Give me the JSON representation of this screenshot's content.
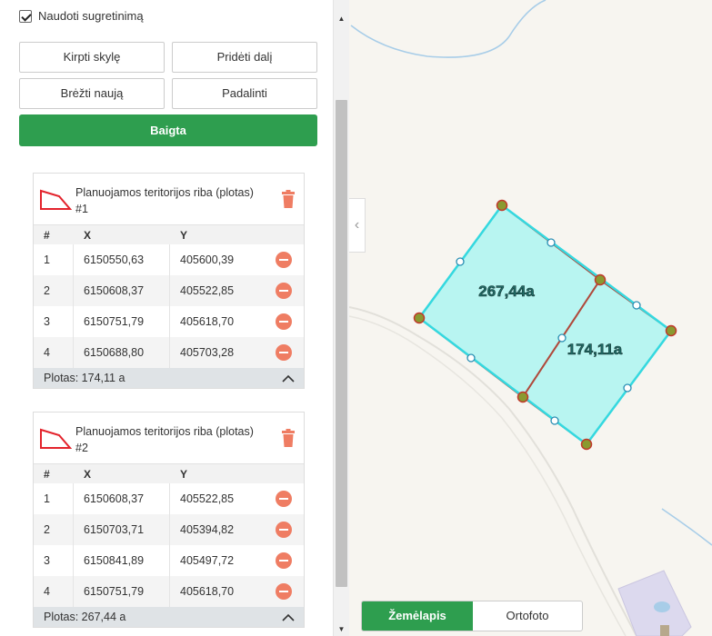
{
  "panel": {
    "checkbox_label": "Naudoti sugretinimą",
    "buttons": {
      "cut_hole": "Kirpti skylę",
      "add_part": "Pridėti dalį",
      "draw_new": "Brėžti naują",
      "split": "Padalinti",
      "done": "Baigta"
    },
    "table_headers": {
      "num": "#",
      "x": "X",
      "y": "Y"
    },
    "cards": [
      {
        "title": "Planuojamos teritorijos riba (plotas) #1",
        "rows": [
          {
            "n": "1",
            "x": "6150550,63",
            "y": "405600,39"
          },
          {
            "n": "2",
            "x": "6150608,37",
            "y": "405522,85"
          },
          {
            "n": "3",
            "x": "6150751,79",
            "y": "405618,70"
          },
          {
            "n": "4",
            "x": "6150688,80",
            "y": "405703,28"
          }
        ],
        "footer": "Plotas: 174,11 a"
      },
      {
        "title": "Planuojamos teritorijos riba (plotas) #2",
        "rows": [
          {
            "n": "1",
            "x": "6150608,37",
            "y": "405522,85"
          },
          {
            "n": "2",
            "x": "6150703,71",
            "y": "405394,82"
          },
          {
            "n": "3",
            "x": "6150841,89",
            "y": "405497,72"
          },
          {
            "n": "4",
            "x": "6150751,79",
            "y": "405618,70"
          }
        ],
        "footer": "Plotas: 267,44 a"
      }
    ]
  },
  "map": {
    "labels": {
      "parcel_a": "267,44a",
      "parcel_b": "174,11a"
    },
    "switch": {
      "map": "Žemėlapis",
      "ortho": "Ortofoto",
      "active": "map"
    },
    "colors": {
      "fill": "#b8f5f1",
      "outline": "#34d9e0",
      "boundary": "#b04a3c",
      "accent": "#2e9e4f"
    }
  },
  "icons": [
    "check-icon",
    "polygon-icon",
    "trash-icon",
    "minus-circle-icon",
    "chevron-up-icon",
    "chevron-left-icon",
    "scroll-up-icon",
    "scroll-down-icon"
  ]
}
